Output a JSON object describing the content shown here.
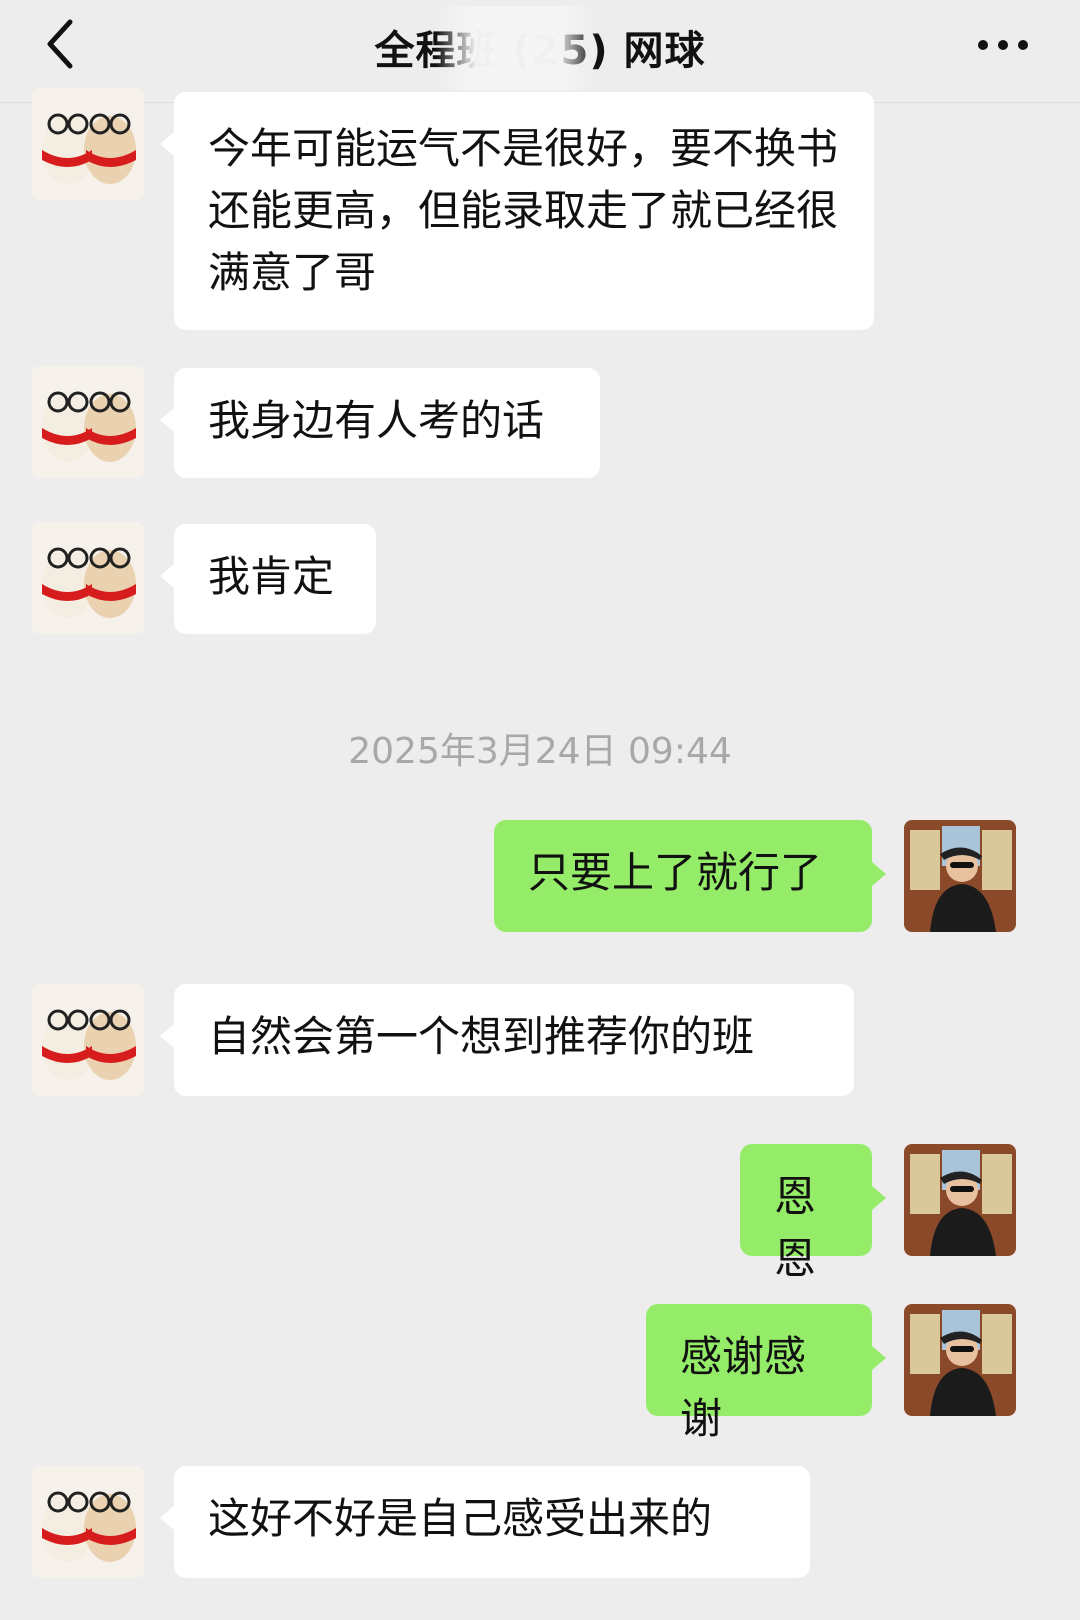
{
  "header": {
    "title": "全程班      (25) 网球",
    "back_icon": "chevron-left-icon",
    "more_icon": "ellipsis-icon"
  },
  "messages": [
    {
      "side": "in",
      "text": "今年可能运气不是很好，要不换书还能更高，但能录取走了就已经很满意了哥"
    },
    {
      "side": "in",
      "text": "我身边有人考的话"
    },
    {
      "side": "in",
      "text": "我肯定"
    },
    {
      "side": "out",
      "text": "只要上了就行了"
    },
    {
      "side": "in",
      "text": "自然会第一个想到推荐你的班"
    },
    {
      "side": "out",
      "text": "恩恩"
    },
    {
      "side": "out",
      "text": "感谢感谢"
    },
    {
      "side": "in",
      "text": "这好不好是自己感受出来的"
    }
  ],
  "timestamp": "2025年3月24日 09:44",
  "colors": {
    "background": "#ededed",
    "incoming_bubble": "#ffffff",
    "outgoing_bubble": "#95ec69",
    "timestamp_text": "#a8a8a8"
  }
}
